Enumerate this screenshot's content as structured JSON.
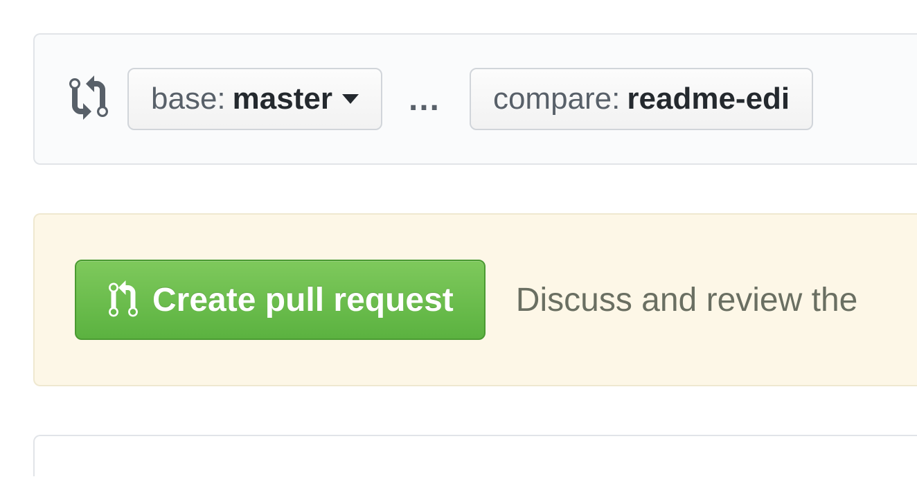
{
  "compare": {
    "base_label": "base:",
    "base_value": "master",
    "separator": "…",
    "compare_label": "compare:",
    "compare_value": "readme-edi"
  },
  "banner": {
    "button_label": "Create pull request",
    "description": "Discuss and review the"
  }
}
